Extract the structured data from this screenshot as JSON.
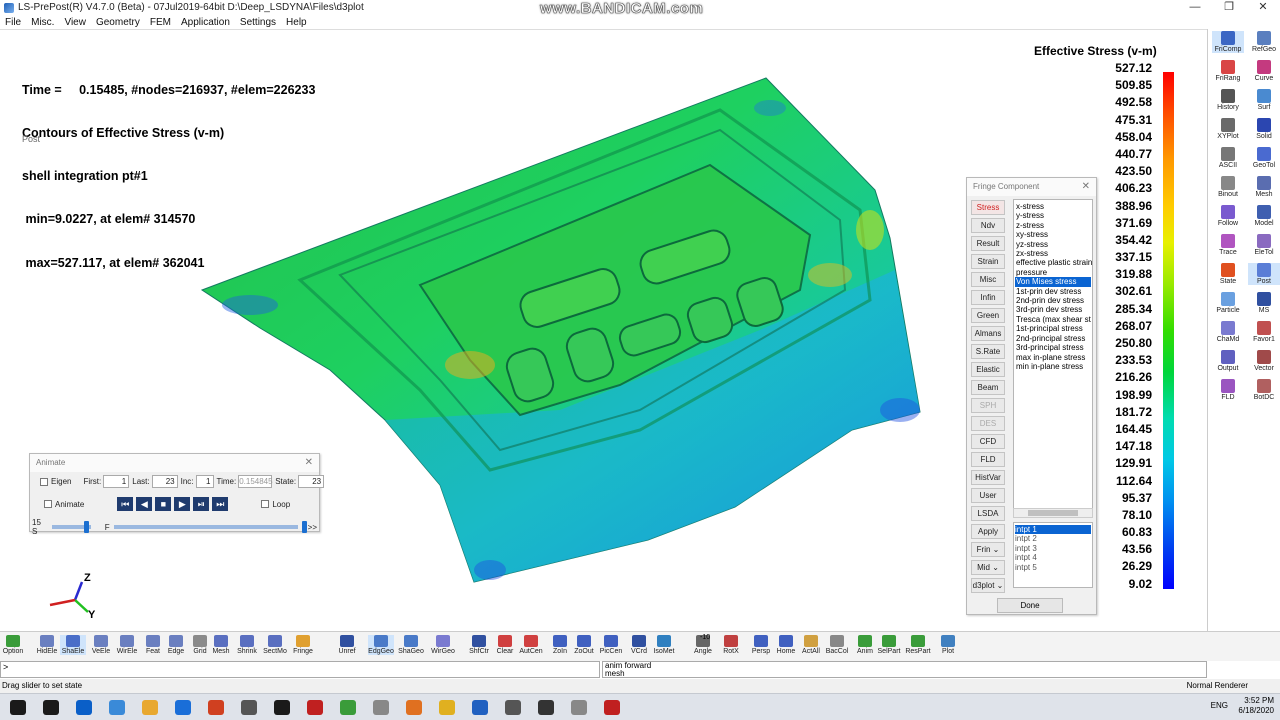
{
  "window": {
    "title": "LS-PrePost(R) V4.7.0 (Beta) - 07Jul2019-64bit D:\\Deep_LSDYNA\\Files\\d3plot",
    "watermark": "www.BANDICAM.com",
    "controls": [
      "—",
      "❐",
      "✕"
    ]
  },
  "menu": [
    "File",
    "Misc.",
    "View",
    "Geometry",
    "FEM",
    "Application",
    "Settings",
    "Help"
  ],
  "viewport": {
    "info_lines": [
      "Time =     0.15485, #nodes=216937, #elem=226233",
      "Contours of Effective Stress (v-m)",
      "shell integration pt#1",
      " min=9.0227, at elem# 314570",
      " max=527.117, at elem# 362041"
    ],
    "post_label": "Post",
    "axis_labels": {
      "z": "Z",
      "y": "Y"
    }
  },
  "legend": {
    "title": "Effective Stress (v-m)",
    "values": [
      "527.12",
      "509.85",
      "492.58",
      "475.31",
      "458.04",
      "440.77",
      "423.50",
      "406.23",
      "388.96",
      "371.69",
      "354.42",
      "337.15",
      "319.88",
      "302.61",
      "285.34",
      "268.07",
      "250.80",
      "233.53",
      "216.26",
      "198.99",
      "181.72",
      "164.45",
      "147.18",
      "129.91",
      "112.64",
      "95.37",
      "78.10",
      "60.83",
      "43.56",
      "26.29",
      "9.02"
    ],
    "colors": {
      "max": "#ff0000",
      "mid": "#33dd00",
      "min": "#0000ff"
    }
  },
  "right_panel": [
    {
      "label": "FriComp",
      "color": "#3a66c4",
      "active": true
    },
    {
      "label": "RefGeo",
      "color": "#5a7fbf"
    },
    {
      "label": "FriRang",
      "color": "#d94545"
    },
    {
      "label": "Curve",
      "color": "#c43a7f"
    },
    {
      "label": "History",
      "color": "#555"
    },
    {
      "label": "Surf",
      "color": "#4a8ad0"
    },
    {
      "label": "XYPlot",
      "color": "#6a6a6a"
    },
    {
      "label": "Solid",
      "color": "#2b46b0"
    },
    {
      "label": "ASCII",
      "color": "#777"
    },
    {
      "label": "GeoTol",
      "color": "#4a6ad0"
    },
    {
      "label": "Binout",
      "color": "#888"
    },
    {
      "label": "Mesh",
      "color": "#5a6db0"
    },
    {
      "label": "Follow",
      "color": "#7a5acf"
    },
    {
      "label": "Model",
      "color": "#3f5fb0"
    },
    {
      "label": "Trace",
      "color": "#b055c0"
    },
    {
      "label": "EleTol",
      "color": "#8a6ac0"
    },
    {
      "label": "State",
      "color": "#e05020"
    },
    {
      "label": "Post",
      "color": "#5b7ed6",
      "active": true
    },
    {
      "label": "Particle",
      "color": "#6aa0e0"
    },
    {
      "label": "MS",
      "color": "#3050a0"
    },
    {
      "label": "ChaMd",
      "color": "#7a7ad0"
    },
    {
      "label": "Favor1",
      "color": "#c05050"
    },
    {
      "label": "Output",
      "color": "#6060c0"
    },
    {
      "label": "Vector",
      "color": "#a04a4a"
    },
    {
      "label": "FLD",
      "color": "#9a55c0"
    },
    {
      "label": "BotDC",
      "color": "#b06060"
    }
  ],
  "fringe_panel": {
    "title": "Fringe Component",
    "close": "✕",
    "buttons": [
      {
        "label": "Stress",
        "state": "sel"
      },
      {
        "label": "Ndv"
      },
      {
        "label": "Result"
      },
      {
        "label": "Strain"
      },
      {
        "label": "Misc"
      },
      {
        "label": "Infin"
      },
      {
        "label": "Green"
      },
      {
        "label": "Almans"
      },
      {
        "label": "S.Rate"
      },
      {
        "label": "Elastic"
      },
      {
        "label": "Beam"
      },
      {
        "label": "SPH",
        "state": "dis"
      },
      {
        "label": "DES",
        "state": "dis"
      },
      {
        "label": "CFD"
      },
      {
        "label": "FLD"
      },
      {
        "label": "HistVar"
      },
      {
        "label": "User"
      },
      {
        "label": "LSDA"
      },
      {
        "label": "Apply"
      },
      {
        "label": "Frin ⌄"
      },
      {
        "label": "Mid ⌄"
      },
      {
        "label": "d3plot ⌄"
      }
    ],
    "components": [
      "x-stress",
      "y-stress",
      "z-stress",
      "xy-stress",
      "yz-stress",
      "zx-stress",
      "effective plastic strain",
      "pressure",
      "Von Mises stress",
      "1st-prin dev stress",
      "2nd-prin dev stress",
      "3rd-prin dev stress",
      "Tresca (max shear st",
      "1st-principal stress",
      "2nd-principal stress",
      "3rd-principal stress",
      "max in-plane stress",
      "min in-plane stress"
    ],
    "selected_component": "Von Mises stress",
    "intpts": [
      "intpt  1",
      "intpt  2",
      "intpt  3",
      "intpt  4",
      "intpt  5"
    ],
    "selected_intpt": "intpt  1",
    "done": "Done"
  },
  "animate_panel": {
    "title": "Animate",
    "close": "✕",
    "eigen": "Eigen",
    "first_label": "First:",
    "first": "1",
    "last_label": "Last:",
    "last": "23",
    "inc_label": "Inc:",
    "inc": "1",
    "time_label": "Time:",
    "time": "0.154845",
    "state_label": "State:",
    "state": "23",
    "animate": "Animate",
    "loop": "Loop",
    "speed_left": "15 S",
    "speed_mid": "F",
    "speed_right": ">>"
  },
  "toolbar": [
    {
      "label": "Option",
      "color": "#3a9c3a"
    },
    {
      "label": "HidEle",
      "color": "#6a7fc0"
    },
    {
      "label": "ShaEle",
      "color": "#4a6ec8",
      "active": true
    },
    {
      "label": "VeEle",
      "color": "#6a7fc0"
    },
    {
      "label": "WirEle",
      "color": "#6a7fc0"
    },
    {
      "label": "Feat",
      "color": "#6a7fc0"
    },
    {
      "label": "Edge",
      "color": "#6a7fc0"
    },
    {
      "label": "Grid",
      "color": "#8a8a8a"
    },
    {
      "label": "Mesh",
      "color": "#5a6fc0"
    },
    {
      "label": "Shrink",
      "color": "#5a6fc0"
    },
    {
      "label": "SectMo",
      "color": "#5a6fc0"
    },
    {
      "label": "Fringe",
      "color": "#e0a030"
    },
    {
      "label": "Unref",
      "color": "#3050a0"
    },
    {
      "label": "EdgGeo",
      "color": "#4a7ac8",
      "active": true
    },
    {
      "label": "ShaGeo",
      "color": "#4a7ac8"
    },
    {
      "label": "WirGeo",
      "color": "#7a7ad0"
    },
    {
      "label": "ShfCtr",
      "color": "#3050a0"
    },
    {
      "label": "Clear",
      "color": "#d04040"
    },
    {
      "label": "AutCen",
      "color": "#d04040"
    },
    {
      "label": "ZoIn",
      "color": "#4060c0"
    },
    {
      "label": "ZoOut",
      "color": "#4060c0"
    },
    {
      "label": "PicCen",
      "color": "#4060c0"
    },
    {
      "label": "VCrd",
      "color": "#3050a0"
    },
    {
      "label": "IsoMet",
      "color": "#3080c0"
    },
    {
      "label": "Angle",
      "color": "#666"
    },
    {
      "label": "RotX",
      "color": "#c04040"
    },
    {
      "label": "Persp",
      "color": "#4060c0"
    },
    {
      "label": "Home",
      "color": "#4060c0"
    },
    {
      "label": "ActAll",
      "color": "#d0a040"
    },
    {
      "label": "BacCol",
      "color": "#888"
    },
    {
      "label": "Anim",
      "color": "#3a9c3a"
    },
    {
      "label": "SelPart",
      "color": "#3a9c3a"
    },
    {
      "label": "ResPart",
      "color": "#3a9c3a"
    },
    {
      "label": "Plot",
      "color": "#4080c0"
    }
  ],
  "angle_value": "-10",
  "cmd": {
    "prompt": ">",
    "history": [
      "anim forward",
      "mesh"
    ]
  },
  "status": {
    "left": "Drag slider to set state",
    "right": "Normal Renderer"
  },
  "taskbar": {
    "time": "3:52 PM",
    "date": "6/18/2020",
    "lang": "ENG",
    "icons": [
      "#1a1a1a",
      "#1a1a1a",
      "#0a5fc8",
      "#3a8ad8",
      "#e8a830",
      "#1a6ed8",
      "#d04020",
      "#555",
      "#1a1a1a",
      "#c02020",
      "#3a9c3a",
      "#888",
      "#e07020",
      "#e0b020",
      "#2060c0",
      "#555",
      "#333",
      "#888",
      "#c02020"
    ]
  }
}
